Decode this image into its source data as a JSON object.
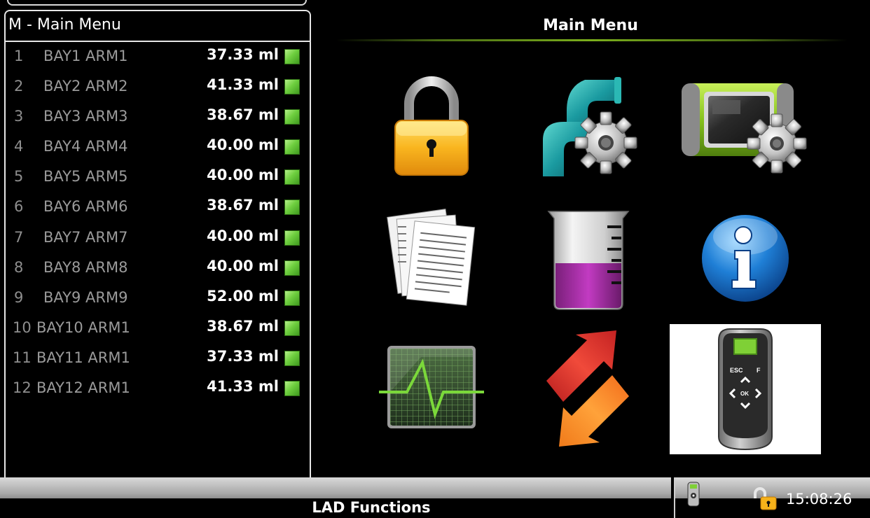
{
  "left_panel": {
    "title": "M - Main Menu",
    "rows": [
      {
        "index": "1",
        "name": "BAY1 ARM1",
        "volume": "37.33 ml"
      },
      {
        "index": "2",
        "name": "BAY2 ARM2",
        "volume": "41.33 ml"
      },
      {
        "index": "3",
        "name": "BAY3 ARM3",
        "volume": "38.67 ml"
      },
      {
        "index": "4",
        "name": "BAY4 ARM4",
        "volume": "40.00 ml"
      },
      {
        "index": "5",
        "name": "BAY5 ARM5",
        "volume": "40.00 ml"
      },
      {
        "index": "6",
        "name": "BAY6 ARM6",
        "volume": "38.67 ml"
      },
      {
        "index": "7",
        "name": "BAY7 ARM7",
        "volume": "40.00 ml"
      },
      {
        "index": "8",
        "name": "BAY8 ARM8",
        "volume": "40.00 ml"
      },
      {
        "index": "9",
        "name": "BAY9 ARM9",
        "volume": "52.00 ml"
      },
      {
        "index": "10",
        "name": "BAY10 ARM1",
        "volume": "38.67 ml"
      },
      {
        "index": "11",
        "name": "BAY11 ARM1",
        "volume": "37.33 ml"
      },
      {
        "index": "12",
        "name": "BAY12 ARM1",
        "volume": "41.33 ml"
      }
    ],
    "status_led_color": "#6fcf3f"
  },
  "main": {
    "title": "Main Menu",
    "tiles": [
      {
        "icon": "padlock-icon"
      },
      {
        "icon": "pipe-gear-icon"
      },
      {
        "icon": "device-gear-icon"
      },
      {
        "icon": "documents-icon"
      },
      {
        "icon": "beaker-icon"
      },
      {
        "icon": "info-icon"
      },
      {
        "icon": "waveform-monitor-icon"
      },
      {
        "icon": "transfer-arrows-icon"
      },
      {
        "icon": "handheld-remote-icon",
        "selected": true
      }
    ],
    "handheld": {
      "esc": "ESC",
      "f": "F",
      "ok": "OK"
    }
  },
  "bottom_bar": {
    "label": "LAD Functions",
    "clock": "15:08:26",
    "status_icons": [
      "handheld-status-icon",
      "unlocked-padlock-icon"
    ]
  },
  "colors": {
    "accent_green": "#7bae1c",
    "led_green": "#6fcf3f",
    "selection_bg": "#ffffff"
  }
}
